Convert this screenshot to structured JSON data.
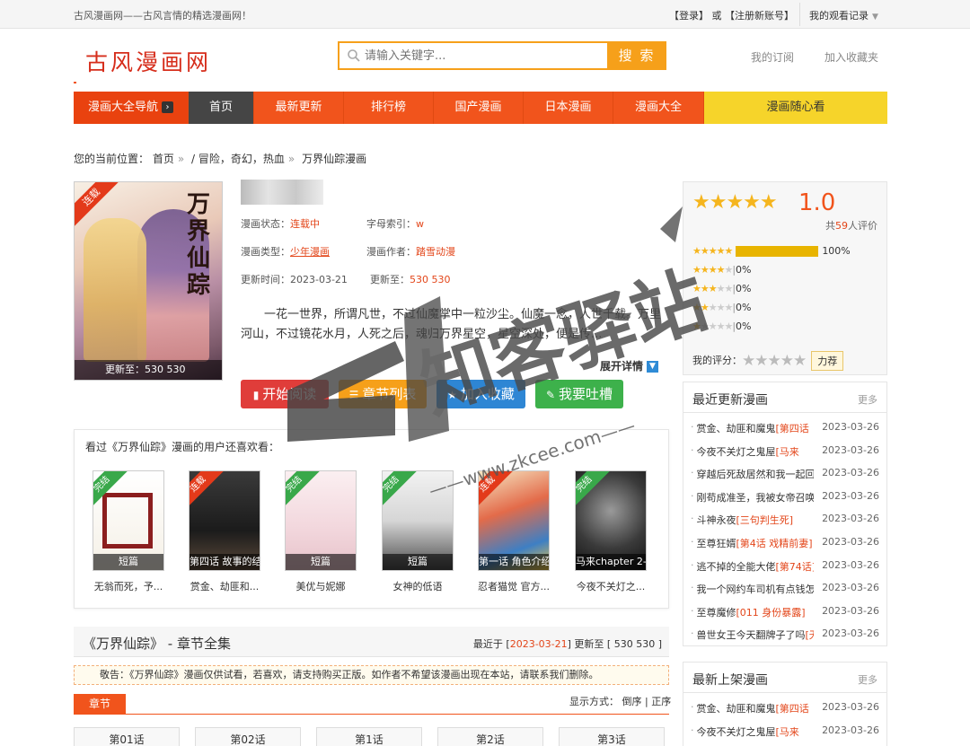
{
  "topbar": {
    "slogan": "古风漫画网——古风言情的精选漫画网！",
    "login": "【登录】",
    "or": "或",
    "register": "【注册新账号】",
    "history": "我的观看记录"
  },
  "header": {
    "logo": "古风漫画网",
    "search_placeholder": "请输入关键字...",
    "search_button": "搜 索",
    "my_subscribe": "我的订阅",
    "add_favorite": "加入收藏夹"
  },
  "nav": {
    "guide": "漫画大全导航",
    "items": [
      "首页",
      "最新更新",
      "排行榜",
      "国产漫画",
      "日本漫画",
      "漫画大全"
    ],
    "random": "漫画随心看"
  },
  "breadcrumb": {
    "prefix": "您的当前位置：",
    "home": "首页",
    "category": "/ 冒险，奇幻，热血",
    "current": "万界仙踪漫画"
  },
  "comic": {
    "cover_title": "万界仙踪",
    "cover_ribbon": "连载",
    "cover_update": "更新至：530 530",
    "status_label": "漫画状态：",
    "status": "连载中",
    "letter_label": "字母索引：",
    "letter": "w",
    "type_label": "漫画类型：",
    "type": "少年漫画",
    "author_label": "漫画作者：",
    "author": "踏雪动漫",
    "time_label": "更新时间：",
    "time": "2023-03-21",
    "update_label": "更新至：",
    "update": "530 530",
    "description": "一花一世界，所谓凡世，不过仙魔掌中一粒沙尘。仙魔一念，人世千载。万里河山，不过镜花水月，人死之后，魂归万界星空，星空深处，便是传...",
    "expand": "展开详情"
  },
  "actions": {
    "read": "开始阅读",
    "chapters": "章节列表",
    "favorite": "加入收藏",
    "comment": "我要吐槽"
  },
  "fans": {
    "title": "看过《万界仙踪》漫画的用户还喜欢看：",
    "items": [
      {
        "ribbon": "完结",
        "label": "短篇",
        "name": "无翁而死，予..."
      },
      {
        "ribbon": "连载",
        "label": "第四话 故事的结",
        "name": "赏金、劫匪和..."
      },
      {
        "ribbon": "完结",
        "label": "短篇",
        "name": "美优与妮娜"
      },
      {
        "ribbon": "完结",
        "label": "短篇",
        "name": "女神的低语"
      },
      {
        "ribbon": "连载",
        "label": "第一话 角色介绍",
        "name": "忍者猫觉 官方..."
      },
      {
        "ribbon": "完结",
        "label": "马来chapter 2-",
        "name": "今夜不关灯之..."
      }
    ]
  },
  "chapters": {
    "title": "《万界仙踪》 - 章节全集",
    "latest_prefix": "最近于 [",
    "latest_date": "2023-03-21",
    "latest_suffix": "] 更新至 [ 530 530 ]",
    "notice": "敬告：《万界仙踪》漫画仅供试看，若喜欢，请支持购买正版。如作者不希望该漫画出现在本站，请联系我们删除。",
    "tab": "章节",
    "order_label": "显示方式：",
    "order_desc": "倒序",
    "order_sep": "|",
    "order_asc": "正序",
    "items": [
      "第01话",
      "第02话",
      "第1话",
      "第2话",
      "第3话"
    ]
  },
  "rating": {
    "stars": "★★★★★",
    "score": "1.0",
    "count_prefix": "共",
    "count": "59",
    "count_suffix": "人评价",
    "rows": [
      {
        "stars": 5,
        "percent": "100%",
        "fill": 1.0
      },
      {
        "stars": 4,
        "percent": "0%",
        "fill": 0
      },
      {
        "stars": 3,
        "percent": "0%",
        "fill": 0
      },
      {
        "stars": 2,
        "percent": "0%",
        "fill": 0
      },
      {
        "stars": 1,
        "percent": "0%",
        "fill": 0
      }
    ],
    "my_label": "我的评分：",
    "my_tag": "力荐"
  },
  "latest_update": {
    "title": "最近更新漫画",
    "more": "更多",
    "items": [
      {
        "name": "赏金、劫匪和魔鬼",
        "tag": "[第四话",
        "date": "2023-03-26"
      },
      {
        "name": "今夜不关灯之鬼屋",
        "tag": "[马来",
        "date": "2023-03-26"
      },
      {
        "name": "穿越后死敌居然和我一起回",
        "tag": "",
        "date": "2023-03-26"
      },
      {
        "name": "刚苟成准圣，我被女帝召唤",
        "tag": "",
        "date": "2023-03-26"
      },
      {
        "name": "斗神永夜",
        "tag": "[三句判生死]",
        "date": "2023-03-26"
      },
      {
        "name": "至尊狂婿",
        "tag": "[第4话 戏精前妻]",
        "date": "2023-03-26"
      },
      {
        "name": "逃不掉的全能大佬",
        "tag": "[第74话]",
        "date": "2023-03-26"
      },
      {
        "name": "我一个网约车司机有点钱怎",
        "tag": "",
        "date": "2023-03-26"
      },
      {
        "name": "至尊魔修",
        "tag": "[011 身份暴露]",
        "date": "2023-03-26"
      },
      {
        "name": "兽世女王今天翻牌子了吗",
        "tag": "[无",
        "date": "2023-03-26"
      }
    ]
  },
  "latest_new": {
    "title": "最新上架漫画",
    "more": "更多",
    "items": [
      {
        "name": "赏金、劫匪和魔鬼",
        "tag": "[第四话",
        "date": "2023-03-26"
      },
      {
        "name": "今夜不关灯之鬼屋",
        "tag": "[马来",
        "date": "2023-03-26"
      }
    ]
  },
  "watermark": {
    "brand": "知客驿站",
    "url": "——www.zkcee.com——"
  },
  "colors": {
    "accent": "#f1541c",
    "nav_home": "#454545",
    "random": "#f6d42a",
    "read_btn": "#e03d3a",
    "chapters_btn": "#f6a01a",
    "favorite_btn": "#2e86d4",
    "comment_btn": "#3db14b"
  }
}
